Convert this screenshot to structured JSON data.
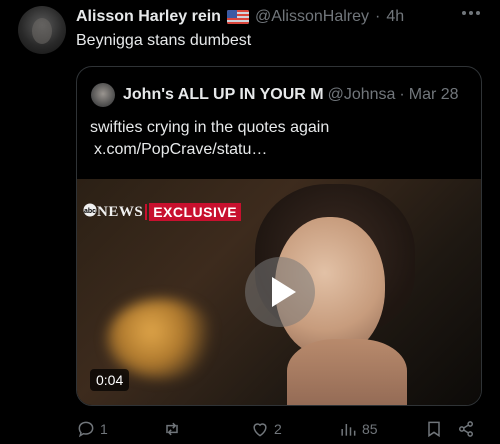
{
  "tweet": {
    "author_name": "Alisson Harley rein",
    "flag": "us-flag",
    "handle": "@AlissonHalrey",
    "separator": "·",
    "time": "4h",
    "text": "Beynigga stans dumbest",
    "more_icon": "more-horizontal-icon"
  },
  "quote": {
    "author_name": "John's ALL UP IN YOUR M",
    "handle": "@Johnsa",
    "separator": "·",
    "time": "Mar 28",
    "text": "swifties crying in the quotes again",
    "link": "x.com/PopCrave/statu…",
    "video": {
      "channel_logo": "abc",
      "network_label": "NEWS",
      "badge": "EXCLUSIVE",
      "duration": "0:04",
      "play_icon": "play-icon"
    }
  },
  "actions": {
    "reply_count": "1",
    "repost_count": "",
    "like_count": "2",
    "views_count": "85"
  },
  "colors": {
    "background": "#000000",
    "text": "#e7e9ea",
    "muted": "#71767b",
    "border": "#2f3336",
    "badge_red": "#c8102e"
  }
}
